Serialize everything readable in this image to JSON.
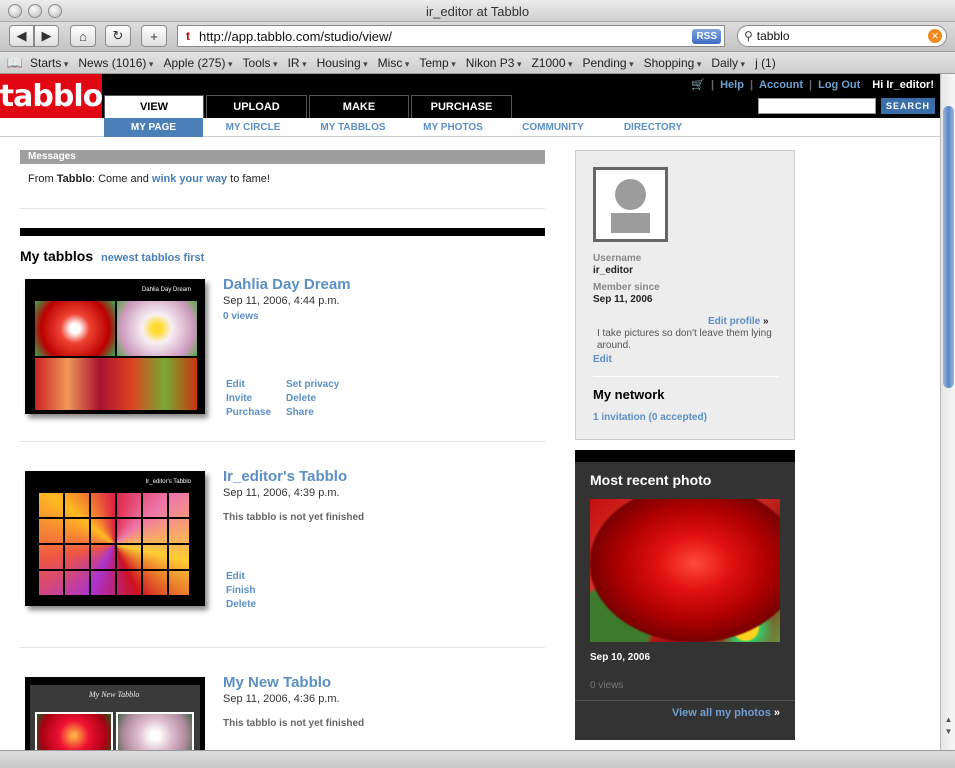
{
  "window": {
    "title": "ir_editor at Tabblo"
  },
  "toolbar": {
    "url": "http://app.tabblo.com/studio/view/",
    "rss_label": "RSS",
    "search_value": "tabblo"
  },
  "bookmarks": [
    "Starts",
    "News (1016)",
    "Apple (275)",
    "Tools",
    "IR",
    "Housing",
    "Misc",
    "Temp",
    "Nikon P3",
    "Z1000",
    "Pending",
    "Shopping",
    "Daily",
    "j (1)"
  ],
  "site": {
    "logo_text": "tabblo",
    "tabs": [
      "VIEW",
      "UPLOAD",
      "MAKE",
      "PURCHASE"
    ],
    "links": {
      "help": "Help",
      "account": "Account",
      "logout": "Log Out",
      "greeting": "Hi Ir_editor!"
    },
    "search_button": "SEARCH",
    "subtabs": [
      "MY PAGE",
      "MY CIRCLE",
      "MY TABBLOS",
      "MY PHOTOS",
      "COMMUNITY",
      "DIRECTORY"
    ]
  },
  "messages": {
    "header": "Messages",
    "from_label": "From",
    "sender": "Tabblo",
    "text_before": ": Come and",
    "link": "wink your way",
    "text_after": "to fame!"
  },
  "tabblos_section": {
    "title": "My tabblos",
    "sort_link": "newest tabblos first"
  },
  "tabblos": [
    {
      "title": "Dahlia Day Dream",
      "date": "Sep 11, 2006, 4:44 p.m.",
      "views": "0 views",
      "thumb_caption": "Dahlia Day Dream",
      "actions_left": [
        "Edit",
        "Invite",
        "Purchase"
      ],
      "actions_right": [
        "Set privacy",
        "Delete",
        "Share"
      ]
    },
    {
      "title": "Ir_editor's Tabblo",
      "date": "Sep 11, 2006, 4:39 p.m.",
      "note": "This tabblo is not yet finished",
      "thumb_caption": "Ir_editor's Tabblo",
      "actions_left": [
        "Edit",
        "Finish",
        "Delete"
      ]
    },
    {
      "title": "My New Tabblo",
      "date": "Sep 11, 2006, 4:36 p.m.",
      "note": "This tabblo is not yet finished",
      "thumb_caption": "My New Tabblo"
    }
  ],
  "profile": {
    "username_label": "Username",
    "username": "ir_editor",
    "member_label": "Member since",
    "member_since": "Sep 11, 2006",
    "edit_profile": "Edit profile",
    "bio": "I take pictures so don't leave them lying around.",
    "edit": "Edit",
    "network_title": "My network",
    "invitations": "1 invitation (0 accepted)"
  },
  "recent_photo": {
    "title": "Most recent photo",
    "date": "Sep 10, 2006",
    "views": "0 views",
    "view_all": "View all my photos"
  },
  "colors": {
    "brand_red": "#e20613",
    "link_blue": "#5b8fc6",
    "nav_blue": "#4a7fb8"
  }
}
